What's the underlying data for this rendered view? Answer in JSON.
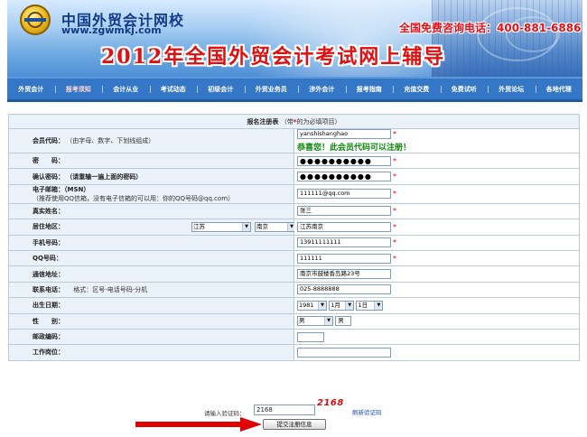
{
  "header": {
    "logo_name": "中国外贸会计网校",
    "logo_url": "www.zgwmkj.com",
    "hotline": "全国免费咨询电话：400-881-6886",
    "headline": "2012年全国外贸会计考试网上辅导"
  },
  "nav": {
    "active_index": 1,
    "items": [
      "外贸会计",
      "报考须知",
      "会计从业",
      "考试动态",
      "初级会计",
      "外贸业务员",
      "涉外会计",
      "报考指南",
      "充值交费",
      "免费试听",
      "外贸论坛",
      "各地代理"
    ]
  },
  "form": {
    "title": "报名注册表",
    "title_note": "（带",
    "title_note_star": "*",
    "title_note_end": "的为必填项目）",
    "rows": {
      "member_code": {
        "label": "会员代码：",
        "hint": "（由字母、数字、下划线组成）",
        "value": "yanshishanghao",
        "ok_message": "恭喜您！此会员代码可以注册！"
      },
      "password": {
        "label": "密　　码：",
        "value": "●●●●●●●●●●"
      },
      "confirm_password": {
        "label": "确认密码：",
        "hint": "（请重输一遍上面的密码）",
        "value": "●●●●●●●●●●"
      },
      "email": {
        "label": "电子邮箱：",
        "label_suffix": "（MSN）",
        "hint": "（推荐使用QQ信箱，没有电子信箱的可以用：你的QQ号码@qq.com）",
        "value": "111111@qq.com"
      },
      "real_name": {
        "label": "真实姓名：",
        "value": "张三"
      },
      "region": {
        "label": "居住地区：",
        "province": "江苏",
        "city": "南京",
        "value": "江苏南京"
      },
      "mobile": {
        "label": "手机号码：",
        "value": "13911111111"
      },
      "qq": {
        "label": "QQ号码：",
        "value": "111111"
      },
      "address": {
        "label": "通信地址：",
        "value": "南京市鼓楼香岛路23号"
      },
      "phone": {
        "label": "联系电话：",
        "hint": "格式：区号-电话号码-分机",
        "value": "025-8888888"
      },
      "birth": {
        "label": "出生日期：",
        "year": "1981",
        "month": "1月",
        "day": "1日"
      },
      "gender": {
        "label": "性　　别：",
        "option": "男",
        "value": "男"
      },
      "postcode": {
        "label": "邮政编码：",
        "value": ""
      },
      "job": {
        "label": "工作岗位：",
        "value": ""
      }
    }
  },
  "captcha": {
    "label": "请输入验证码：",
    "value": "2168",
    "image_text": "2168",
    "refresh": "刷新验证码"
  },
  "submit": {
    "label": "提交注册信息"
  },
  "colors": {
    "nav_bg": "#3477c6",
    "headline": "#e01010",
    "ok_message": "#0a8a0a",
    "required": "#e00000",
    "arrow": "#e00000"
  }
}
